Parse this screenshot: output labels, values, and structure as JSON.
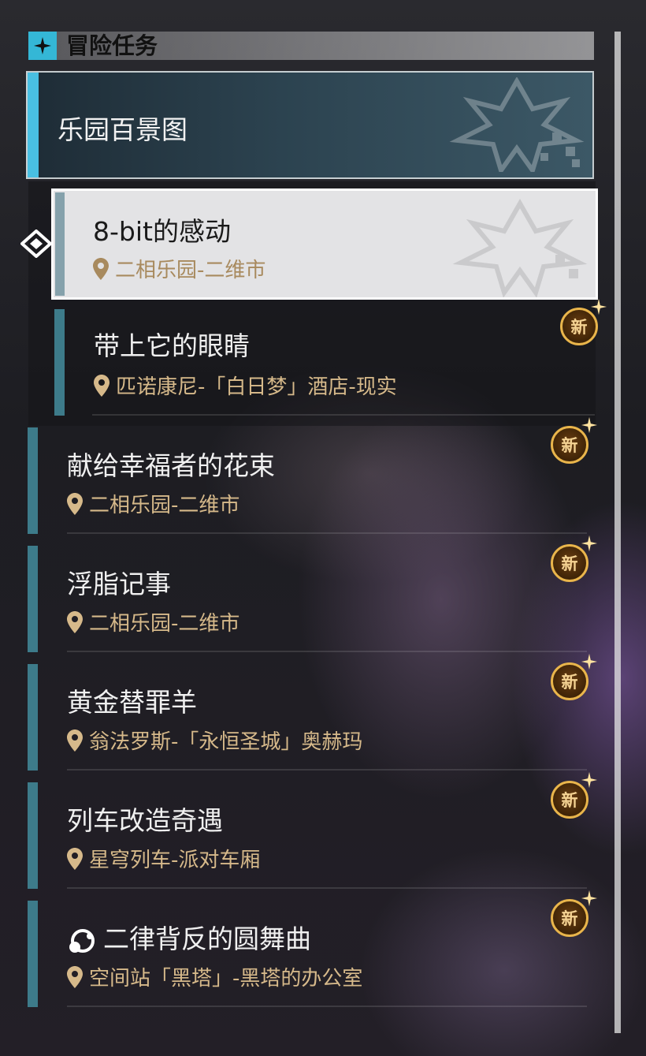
{
  "header": {
    "title": "冒险任务",
    "icon": "sparkle-icon"
  },
  "category": {
    "title": "乐园百景图"
  },
  "quests": [
    {
      "title": "8-bit的感动",
      "location": "二相乐园-二维市",
      "selected": true,
      "new": false
    },
    {
      "title": "带上它的眼睛",
      "location": "匹诺康尼-「白日梦」酒店-现实",
      "new": true,
      "badge": "新"
    },
    {
      "title": "献给幸福者的花束",
      "location": "二相乐园-二维市",
      "new": true,
      "badge": "新"
    },
    {
      "title": "浮脂记事",
      "location": "二相乐园-二维市",
      "new": true,
      "badge": "新"
    },
    {
      "title": "黄金替罪羊",
      "location": "翁法罗斯-「永恒圣城」奥赫玛",
      "new": true,
      "badge": "新"
    },
    {
      "title": "列车改造奇遇",
      "location": "星穹列车-派对车厢",
      "new": true,
      "badge": "新"
    },
    {
      "title": "二律背反的圆舞曲",
      "location": "空间站「黑塔」-黑塔的办公室",
      "new": true,
      "badge": "新",
      "icon": "path-orbit-icon"
    }
  ],
  "colors": {
    "accent": "#49bfe2",
    "location_text": "#d6b98a",
    "badge_gold": "#e9b54b"
  }
}
